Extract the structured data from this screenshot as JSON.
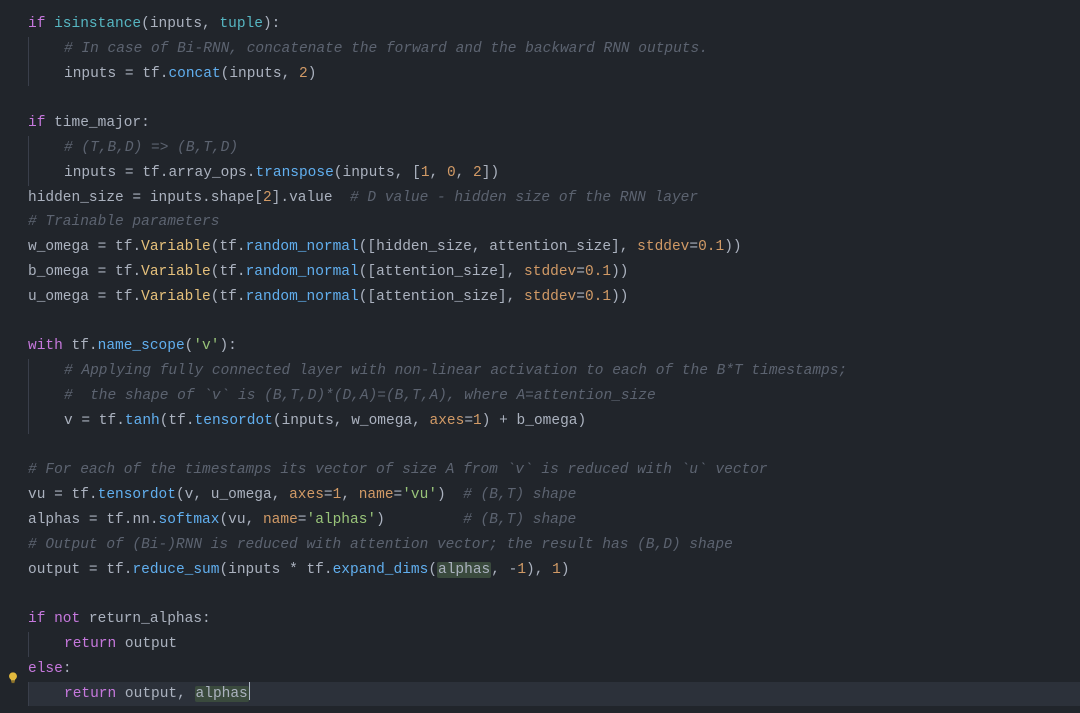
{
  "lines": [
    {
      "segs": [
        {
          "t": "if ",
          "c": "kw"
        },
        {
          "t": "isinstance",
          "c": "bi"
        },
        {
          "t": "(inputs",
          "c": "id"
        },
        {
          "t": ",",
          "c": "op"
        },
        {
          "t": " tuple",
          "c": "bi"
        },
        {
          "t": "):",
          "c": "id"
        }
      ],
      "indent": 0
    },
    {
      "segs": [
        {
          "t": "# In case of Bi-RNN, concatenate the forward and the backward RNN outputs.",
          "c": "cm"
        }
      ],
      "indent": 1,
      "guide": true
    },
    {
      "segs": [
        {
          "t": "inputs ",
          "c": "id"
        },
        {
          "t": "=",
          "c": "op"
        },
        {
          "t": " tf",
          "c": "id"
        },
        {
          "t": ".",
          "c": "op"
        },
        {
          "t": "concat",
          "c": "fn"
        },
        {
          "t": "(inputs",
          "c": "id"
        },
        {
          "t": ",",
          "c": "op"
        },
        {
          "t": " ",
          "c": "id"
        },
        {
          "t": "2",
          "c": "nu"
        },
        {
          "t": ")",
          "c": "id"
        }
      ],
      "indent": 1,
      "guide": true
    },
    {
      "segs": [],
      "indent": 0
    },
    {
      "segs": [
        {
          "t": "if ",
          "c": "kw"
        },
        {
          "t": "time_major",
          "c": "id"
        },
        {
          "t": ":",
          "c": "id"
        }
      ],
      "indent": 0
    },
    {
      "segs": [
        {
          "t": "# (T,B,D) => (B,T,D)",
          "c": "cm"
        }
      ],
      "indent": 1,
      "guide": true
    },
    {
      "segs": [
        {
          "t": "inputs ",
          "c": "id"
        },
        {
          "t": "=",
          "c": "op"
        },
        {
          "t": " tf",
          "c": "id"
        },
        {
          "t": ".",
          "c": "op"
        },
        {
          "t": "array_ops",
          "c": "id"
        },
        {
          "t": ".",
          "c": "op"
        },
        {
          "t": "transpose",
          "c": "fn"
        },
        {
          "t": "(inputs",
          "c": "id"
        },
        {
          "t": ",",
          "c": "op"
        },
        {
          "t": " [",
          "c": "id"
        },
        {
          "t": "1",
          "c": "nu"
        },
        {
          "t": ",",
          "c": "op"
        },
        {
          "t": " ",
          "c": "id"
        },
        {
          "t": "0",
          "c": "nu"
        },
        {
          "t": ",",
          "c": "op"
        },
        {
          "t": " ",
          "c": "id"
        },
        {
          "t": "2",
          "c": "nu"
        },
        {
          "t": "])",
          "c": "id"
        }
      ],
      "indent": 1,
      "guide": true
    },
    {
      "segs": [
        {
          "t": "hidden_size ",
          "c": "id"
        },
        {
          "t": "=",
          "c": "op"
        },
        {
          "t": " inputs",
          "c": "id"
        },
        {
          "t": ".",
          "c": "op"
        },
        {
          "t": "shape",
          "c": "id"
        },
        {
          "t": "[",
          "c": "id"
        },
        {
          "t": "2",
          "c": "nu"
        },
        {
          "t": "]",
          "c": "id"
        },
        {
          "t": ".",
          "c": "op"
        },
        {
          "t": "value  ",
          "c": "id"
        },
        {
          "t": "# D value - hidden size of the RNN layer",
          "c": "cm"
        }
      ],
      "indent": 0
    },
    {
      "segs": [
        {
          "t": "# Trainable parameters",
          "c": "cm"
        }
      ],
      "indent": 0
    },
    {
      "segs": [
        {
          "t": "w_omega ",
          "c": "id"
        },
        {
          "t": "=",
          "c": "op"
        },
        {
          "t": " tf",
          "c": "id"
        },
        {
          "t": ".",
          "c": "op"
        },
        {
          "t": "Variable",
          "c": "fn2"
        },
        {
          "t": "(tf",
          "c": "id"
        },
        {
          "t": ".",
          "c": "op"
        },
        {
          "t": "random_normal",
          "c": "fn"
        },
        {
          "t": "([hidden_size",
          "c": "id"
        },
        {
          "t": ",",
          "c": "op"
        },
        {
          "t": " attention_size]",
          "c": "id"
        },
        {
          "t": ",",
          "c": "op"
        },
        {
          "t": " ",
          "c": "id"
        },
        {
          "t": "stddev",
          "c": "pa"
        },
        {
          "t": "=",
          "c": "op"
        },
        {
          "t": "0.1",
          "c": "nu"
        },
        {
          "t": "))",
          "c": "id"
        }
      ],
      "indent": 0
    },
    {
      "segs": [
        {
          "t": "b_omega ",
          "c": "id"
        },
        {
          "t": "=",
          "c": "op"
        },
        {
          "t": " tf",
          "c": "id"
        },
        {
          "t": ".",
          "c": "op"
        },
        {
          "t": "Variable",
          "c": "fn2"
        },
        {
          "t": "(tf",
          "c": "id"
        },
        {
          "t": ".",
          "c": "op"
        },
        {
          "t": "random_normal",
          "c": "fn"
        },
        {
          "t": "([attention_size]",
          "c": "id"
        },
        {
          "t": ",",
          "c": "op"
        },
        {
          "t": " ",
          "c": "id"
        },
        {
          "t": "stddev",
          "c": "pa"
        },
        {
          "t": "=",
          "c": "op"
        },
        {
          "t": "0.1",
          "c": "nu"
        },
        {
          "t": "))",
          "c": "id"
        }
      ],
      "indent": 0
    },
    {
      "segs": [
        {
          "t": "u_omega ",
          "c": "id"
        },
        {
          "t": "=",
          "c": "op"
        },
        {
          "t": " tf",
          "c": "id"
        },
        {
          "t": ".",
          "c": "op"
        },
        {
          "t": "Variable",
          "c": "fn2"
        },
        {
          "t": "(tf",
          "c": "id"
        },
        {
          "t": ".",
          "c": "op"
        },
        {
          "t": "random_normal",
          "c": "fn"
        },
        {
          "t": "([attention_size]",
          "c": "id"
        },
        {
          "t": ",",
          "c": "op"
        },
        {
          "t": " ",
          "c": "id"
        },
        {
          "t": "stddev",
          "c": "pa"
        },
        {
          "t": "=",
          "c": "op"
        },
        {
          "t": "0.1",
          "c": "nu"
        },
        {
          "t": "))",
          "c": "id"
        }
      ],
      "indent": 0
    },
    {
      "segs": [],
      "indent": 0
    },
    {
      "segs": [
        {
          "t": "with ",
          "c": "kw"
        },
        {
          "t": "tf",
          "c": "id"
        },
        {
          "t": ".",
          "c": "op"
        },
        {
          "t": "name_scope",
          "c": "fn"
        },
        {
          "t": "(",
          "c": "id"
        },
        {
          "t": "'v'",
          "c": "st"
        },
        {
          "t": "):",
          "c": "id"
        }
      ],
      "indent": 0
    },
    {
      "segs": [
        {
          "t": "# Applying fully connected layer with non-linear activation to each of the B*T timestamps;",
          "c": "cm"
        }
      ],
      "indent": 1,
      "guide": true
    },
    {
      "segs": [
        {
          "t": "#  the shape of `v` is (B,T,D)*(D,A)=(B,T,A), where A=attention_size",
          "c": "cm"
        }
      ],
      "indent": 1,
      "guide": true
    },
    {
      "segs": [
        {
          "t": "v ",
          "c": "id"
        },
        {
          "t": "=",
          "c": "op"
        },
        {
          "t": " tf",
          "c": "id"
        },
        {
          "t": ".",
          "c": "op"
        },
        {
          "t": "tanh",
          "c": "fn"
        },
        {
          "t": "(tf",
          "c": "id"
        },
        {
          "t": ".",
          "c": "op"
        },
        {
          "t": "tensordot",
          "c": "fn"
        },
        {
          "t": "(inputs",
          "c": "id"
        },
        {
          "t": ",",
          "c": "op"
        },
        {
          "t": " w_omega",
          "c": "id"
        },
        {
          "t": ",",
          "c": "op"
        },
        {
          "t": " ",
          "c": "id"
        },
        {
          "t": "axes",
          "c": "pa"
        },
        {
          "t": "=",
          "c": "op"
        },
        {
          "t": "1",
          "c": "nu"
        },
        {
          "t": ") ",
          "c": "id"
        },
        {
          "t": "+",
          "c": "op"
        },
        {
          "t": " b_omega)",
          "c": "id"
        }
      ],
      "indent": 1,
      "guide": true
    },
    {
      "segs": [],
      "indent": 0
    },
    {
      "segs": [
        {
          "t": "# For each of the timestamps its vector of size A from `v` is reduced with `u` vector",
          "c": "cm"
        }
      ],
      "indent": 0
    },
    {
      "segs": [
        {
          "t": "vu ",
          "c": "id"
        },
        {
          "t": "=",
          "c": "op"
        },
        {
          "t": " tf",
          "c": "id"
        },
        {
          "t": ".",
          "c": "op"
        },
        {
          "t": "tensordot",
          "c": "fn"
        },
        {
          "t": "(v",
          "c": "id"
        },
        {
          "t": ",",
          "c": "op"
        },
        {
          "t": " u_omega",
          "c": "id"
        },
        {
          "t": ",",
          "c": "op"
        },
        {
          "t": " ",
          "c": "id"
        },
        {
          "t": "axes",
          "c": "pa"
        },
        {
          "t": "=",
          "c": "op"
        },
        {
          "t": "1",
          "c": "nu"
        },
        {
          "t": ",",
          "c": "op"
        },
        {
          "t": " ",
          "c": "id"
        },
        {
          "t": "name",
          "c": "pa"
        },
        {
          "t": "=",
          "c": "op"
        },
        {
          "t": "'vu'",
          "c": "st"
        },
        {
          "t": ")  ",
          "c": "id"
        },
        {
          "t": "# (B,T) shape",
          "c": "cm"
        }
      ],
      "indent": 0
    },
    {
      "segs": [
        {
          "t": "alphas ",
          "c": "id"
        },
        {
          "t": "=",
          "c": "op"
        },
        {
          "t": " tf",
          "c": "id"
        },
        {
          "t": ".",
          "c": "op"
        },
        {
          "t": "nn",
          "c": "id"
        },
        {
          "t": ".",
          "c": "op"
        },
        {
          "t": "softmax",
          "c": "fn"
        },
        {
          "t": "(vu",
          "c": "id"
        },
        {
          "t": ",",
          "c": "op"
        },
        {
          "t": " ",
          "c": "id"
        },
        {
          "t": "name",
          "c": "pa"
        },
        {
          "t": "=",
          "c": "op"
        },
        {
          "t": "'alphas'",
          "c": "st"
        },
        {
          "t": ")         ",
          "c": "id"
        },
        {
          "t": "# (B,T) shape",
          "c": "cm"
        }
      ],
      "indent": 0
    },
    {
      "segs": [
        {
          "t": "# Output of (Bi-)RNN is reduced with attention vector; the result has (B,D) shape",
          "c": "cm"
        }
      ],
      "indent": 0
    },
    {
      "segs": [
        {
          "t": "output ",
          "c": "id"
        },
        {
          "t": "=",
          "c": "op"
        },
        {
          "t": " tf",
          "c": "id"
        },
        {
          "t": ".",
          "c": "op"
        },
        {
          "t": "reduce_sum",
          "c": "fn"
        },
        {
          "t": "(inputs ",
          "c": "id"
        },
        {
          "t": "*",
          "c": "op"
        },
        {
          "t": " tf",
          "c": "id"
        },
        {
          "t": ".",
          "c": "op"
        },
        {
          "t": "expand_dims",
          "c": "fn"
        },
        {
          "t": "(",
          "c": "id"
        },
        {
          "t": "alphas",
          "c": "id",
          "hl": true
        },
        {
          "t": ",",
          "c": "op"
        },
        {
          "t": " ",
          "c": "id"
        },
        {
          "t": "-",
          "c": "op"
        },
        {
          "t": "1",
          "c": "nu"
        },
        {
          "t": ")",
          "c": "id"
        },
        {
          "t": ",",
          "c": "op"
        },
        {
          "t": " ",
          "c": "id"
        },
        {
          "t": "1",
          "c": "nu"
        },
        {
          "t": ")",
          "c": "id"
        }
      ],
      "indent": 0
    },
    {
      "segs": [],
      "indent": 0
    },
    {
      "segs": [
        {
          "t": "if ",
          "c": "kw"
        },
        {
          "t": "not ",
          "c": "kw"
        },
        {
          "t": "return_alphas",
          "c": "id"
        },
        {
          "t": ":",
          "c": "id"
        }
      ],
      "indent": 0
    },
    {
      "segs": [
        {
          "t": "return ",
          "c": "kw"
        },
        {
          "t": "output",
          "c": "id"
        }
      ],
      "indent": 1,
      "guide": true
    },
    {
      "segs": [
        {
          "t": "else",
          "c": "kw"
        },
        {
          "t": ":",
          "c": "id"
        }
      ],
      "indent": 0
    },
    {
      "segs": [
        {
          "t": "return ",
          "c": "kw"
        },
        {
          "t": "output",
          "c": "id"
        },
        {
          "t": ",",
          "c": "op"
        },
        {
          "t": " ",
          "c": "id"
        },
        {
          "t": "alphas",
          "c": "id",
          "hl": true
        }
      ],
      "indent": 1,
      "guide": true,
      "current": true,
      "cursor": true
    }
  ],
  "icons": {
    "bulb": "lightbulb-icon"
  }
}
